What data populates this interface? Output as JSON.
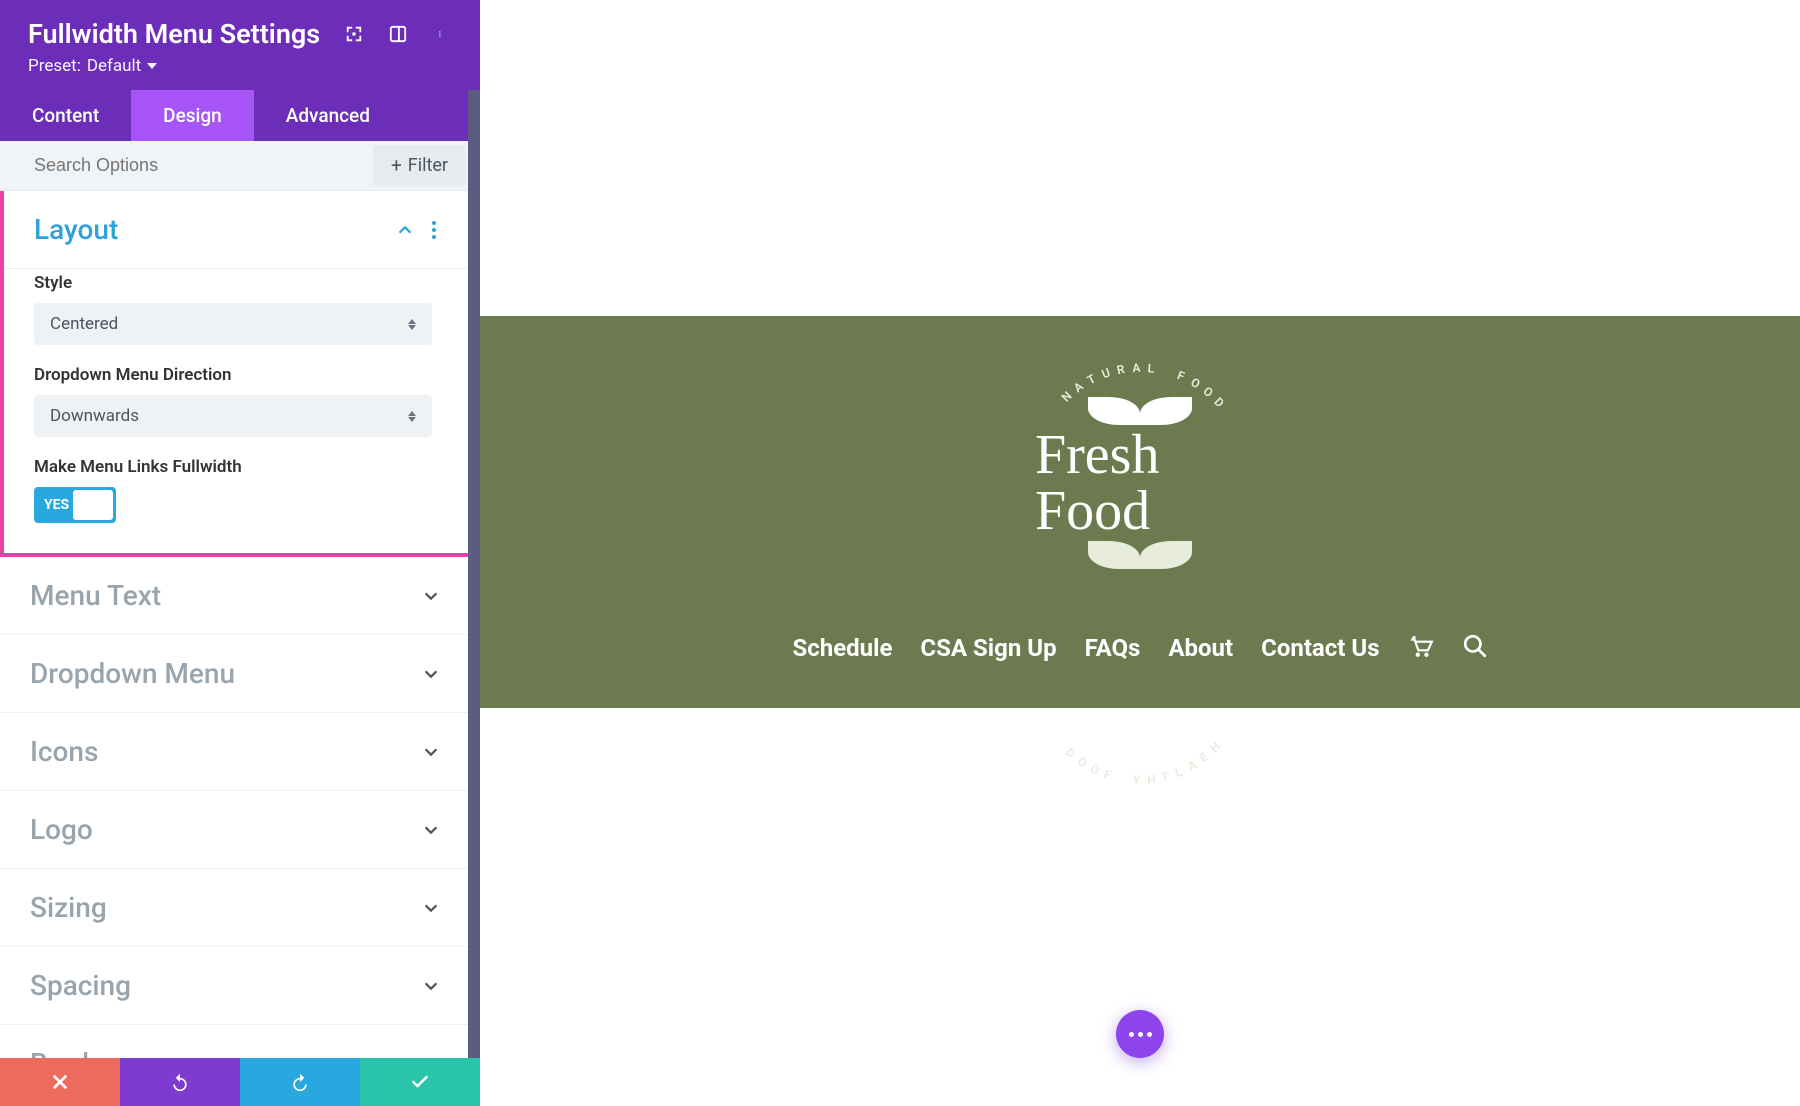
{
  "header": {
    "title": "Fullwidth Menu Settings",
    "preset_label": "Preset:",
    "preset_value": "Default"
  },
  "tabs": {
    "content": "Content",
    "design": "Design",
    "advanced": "Advanced",
    "active": "design"
  },
  "search": {
    "placeholder": "Search Options",
    "filter_label": "Filter"
  },
  "sections": {
    "layout": {
      "title": "Layout",
      "style_label": "Style",
      "style_value": "Centered",
      "direction_label": "Dropdown Menu Direction",
      "direction_value": "Downwards",
      "fullwidth_label": "Make Menu Links Fullwidth",
      "fullwidth_toggle": "YES"
    },
    "collapsed": [
      "Menu Text",
      "Dropdown Menu",
      "Icons",
      "Logo",
      "Sizing",
      "Spacing",
      "Border"
    ]
  },
  "preview": {
    "logo_top_arc": "NATURAL FOOD",
    "brand": "Fresh Food",
    "logo_bottom_arc": "HEALTHY FOOD",
    "nav_items": [
      "Schedule",
      "CSA Sign Up",
      "FAQs",
      "About",
      "Contact Us"
    ]
  },
  "colors": {
    "menu_bg": "#6d7a50",
    "panel_purple": "#6c2eb9",
    "active_tab": "#a855f7",
    "accent_blue": "#29a7df",
    "highlight": "#e71e98"
  }
}
